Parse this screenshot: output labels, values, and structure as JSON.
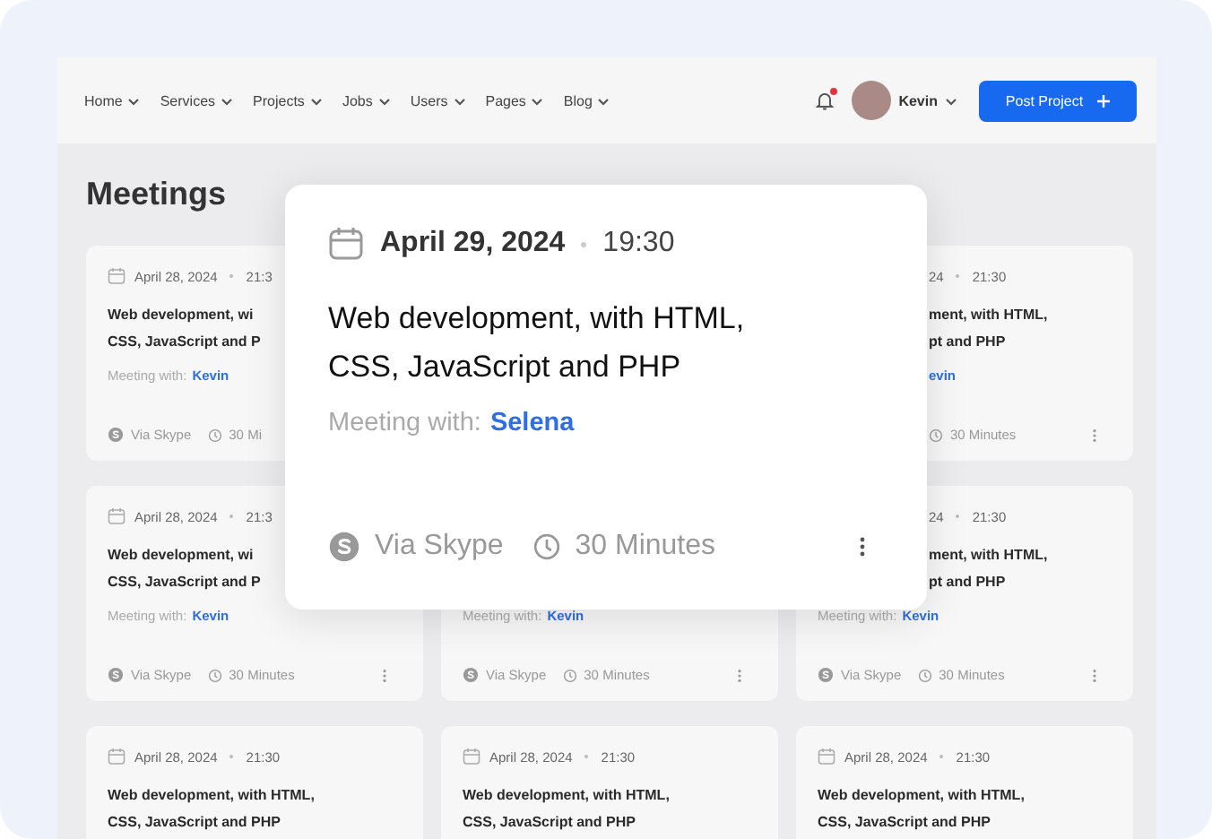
{
  "nav": {
    "items": [
      {
        "label": "Home"
      },
      {
        "label": "Services"
      },
      {
        "label": "Projects"
      },
      {
        "label": "Jobs"
      },
      {
        "label": "Users"
      },
      {
        "label": "Pages"
      },
      {
        "label": "Blog"
      }
    ],
    "notifications": {
      "unread": true
    },
    "user": {
      "name": "Kevin"
    },
    "post_button": {
      "label": "Post Project"
    }
  },
  "page_title": "Meetings",
  "meetings": [
    {
      "kind": "card",
      "date": "April 28, 2024",
      "time": "21:3",
      "title": "Web development, wi\nCSS, JavaScript and P",
      "meeting_label": "Meeting with:",
      "person": "Kevin",
      "via": "Via Skype",
      "duration": "30 Mi"
    },
    {
      "kind": "expanded",
      "date": "April 29, 2024",
      "time": "19:30",
      "title": "Web development, with HTML,\nCSS, JavaScript and PHP",
      "meeting_label": "Meeting with:",
      "person": "Selena",
      "via": "Via Skype",
      "duration": "30 Minutes"
    },
    {
      "kind": "card",
      "date": "24",
      "time": "21:30",
      "title": "ment, with HTML,\npt and PHP",
      "person": "evin",
      "duration": "30 Minutes",
      "top_cut_left": true,
      "bottom_cut_left": true
    },
    {
      "kind": "card",
      "date": "April 28, 2024",
      "time": "21:3",
      "title": "Web development, wi\nCSS, JavaScript and P",
      "meeting_label": "Meeting with:",
      "person": "Kevin",
      "via": "Via Skype",
      "duration": "30 Minutes"
    },
    {
      "kind": "card",
      "meeting_label": "Meeting with:",
      "person": "Kevin",
      "via": "Via Skype",
      "duration": "30 Minutes"
    },
    {
      "kind": "card",
      "date": "24",
      "time": "21:30",
      "title": "ment, with HTML,\npt and PHP",
      "meeting_label": "Meeting with:",
      "person": "Kevin",
      "via": "Via Skype",
      "duration": "30 Minutes",
      "top_cut_left": true
    },
    {
      "kind": "card",
      "date": "April 28, 2024",
      "time": "21:30",
      "title": "Web development, with HTML,\nCSS, JavaScript and PHP"
    },
    {
      "kind": "card",
      "date": "April 28, 2024",
      "time": "21:30",
      "title": "Web development, with HTML,\nCSS, JavaScript and PHP"
    },
    {
      "kind": "card",
      "date": "April 28, 2024",
      "time": "21:30",
      "title": "Web development, with HTML,\nCSS, JavaScript and PHP"
    }
  ]
}
